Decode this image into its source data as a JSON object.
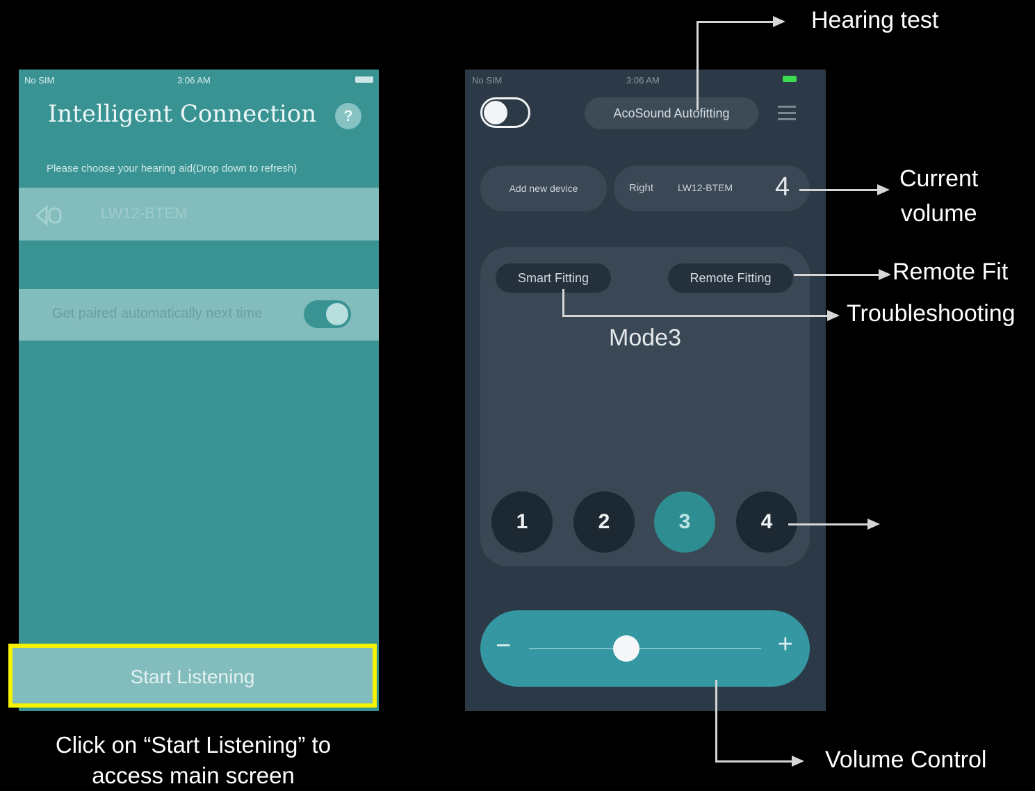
{
  "left_screen": {
    "status": {
      "carrier": "No SIM",
      "time": "3:06 AM"
    },
    "title": "Intelligent Connection",
    "help_icon_label": "?",
    "prompt": "Please choose your hearing aid(Drop down to refresh)",
    "device": {
      "name": "LW12-BTEM"
    },
    "auto_pair": {
      "label": "Get paired automatically next time",
      "enabled": true
    },
    "start_button": "Start Listening"
  },
  "right_screen": {
    "status": {
      "carrier": "No SIM",
      "time": "3:06 AM"
    },
    "power_on": true,
    "autofitting_button": "AcoSound Autofitting",
    "add_device_button": "Add new device",
    "device": {
      "side": "Right",
      "name": "LW12-BTEM",
      "volume": "4"
    },
    "smart_fitting_button": "Smart Fitting",
    "remote_fitting_button": "Remote Fitting",
    "mode_name": "Mode3",
    "modes": [
      "1",
      "2",
      "3",
      "4"
    ],
    "active_mode": "3",
    "volume": {
      "minus": "−",
      "plus": "+",
      "level": 0.42
    }
  },
  "annotations": {
    "hearing_test": "Hearing test",
    "current_volume_line1": "Current",
    "current_volume_line2": "volume",
    "remote_fit": "Remote Fit",
    "troubleshooting": "Troubleshooting",
    "volume_control": "Volume Control",
    "caption_line1": "Click on “Start Listening” to",
    "caption_line2": "access main screen"
  },
  "colors": {
    "left_bg": "#3a9393",
    "right_bg": "#2b3a46",
    "highlight": "#f6f200",
    "accent": "#3497a2"
  }
}
